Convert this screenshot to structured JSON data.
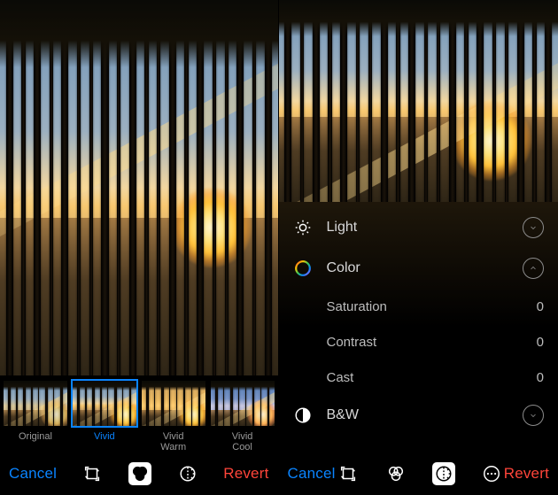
{
  "left": {
    "cancel": "Cancel",
    "revert": "Revert",
    "filters": [
      {
        "id": "original",
        "label": "Original",
        "variant": "original"
      },
      {
        "id": "vivid",
        "label": "Vivid",
        "variant": "vivid",
        "selected": true
      },
      {
        "id": "vividwarm",
        "label": "Vivid\nWarm",
        "variant": "warm"
      },
      {
        "id": "vividcool",
        "label": "Vivid\nCool",
        "variant": "cool"
      }
    ],
    "tools": {
      "selected": "filters"
    }
  },
  "right": {
    "cancel": "Cancel",
    "revert": "Revert",
    "adjust": {
      "light": {
        "label": "Light",
        "expanded": false
      },
      "color": {
        "label": "Color",
        "expanded": true,
        "params": [
          {
            "name": "Saturation",
            "value": "0"
          },
          {
            "name": "Contrast",
            "value": "0"
          },
          {
            "name": "Cast",
            "value": "0"
          }
        ]
      },
      "bw": {
        "label": "B&W",
        "expanded": false
      }
    },
    "tools": {
      "selected": "adjust"
    }
  }
}
